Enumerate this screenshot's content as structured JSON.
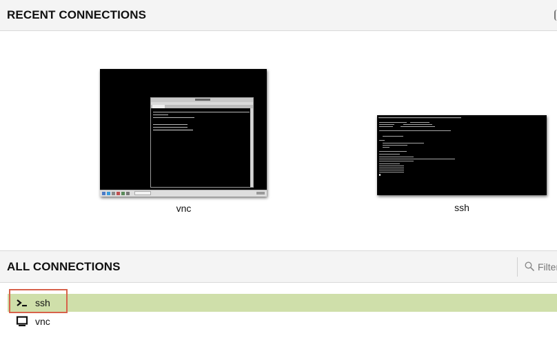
{
  "recent": {
    "title": "RECENT CONNECTIONS",
    "items": [
      {
        "label": "vnc",
        "kind": "vnc",
        "icon": "desktop-screenshot"
      },
      {
        "label": "ssh",
        "kind": "ssh",
        "icon": "terminal-screenshot"
      }
    ]
  },
  "all": {
    "title": "ALL CONNECTIONS",
    "filter": {
      "placeholder": "Filter",
      "value": "",
      "icon": "search-icon"
    },
    "items": [
      {
        "label": "ssh",
        "icon": "terminal-icon",
        "selected": true
      },
      {
        "label": "vnc",
        "icon": "desktop-icon",
        "selected": false
      }
    ]
  },
  "colors": {
    "header_bg": "#f4f4f4",
    "selected_row": "#cfdfaa",
    "selected_outline": "#d7614a",
    "thumbnail_bg": "#000000"
  }
}
